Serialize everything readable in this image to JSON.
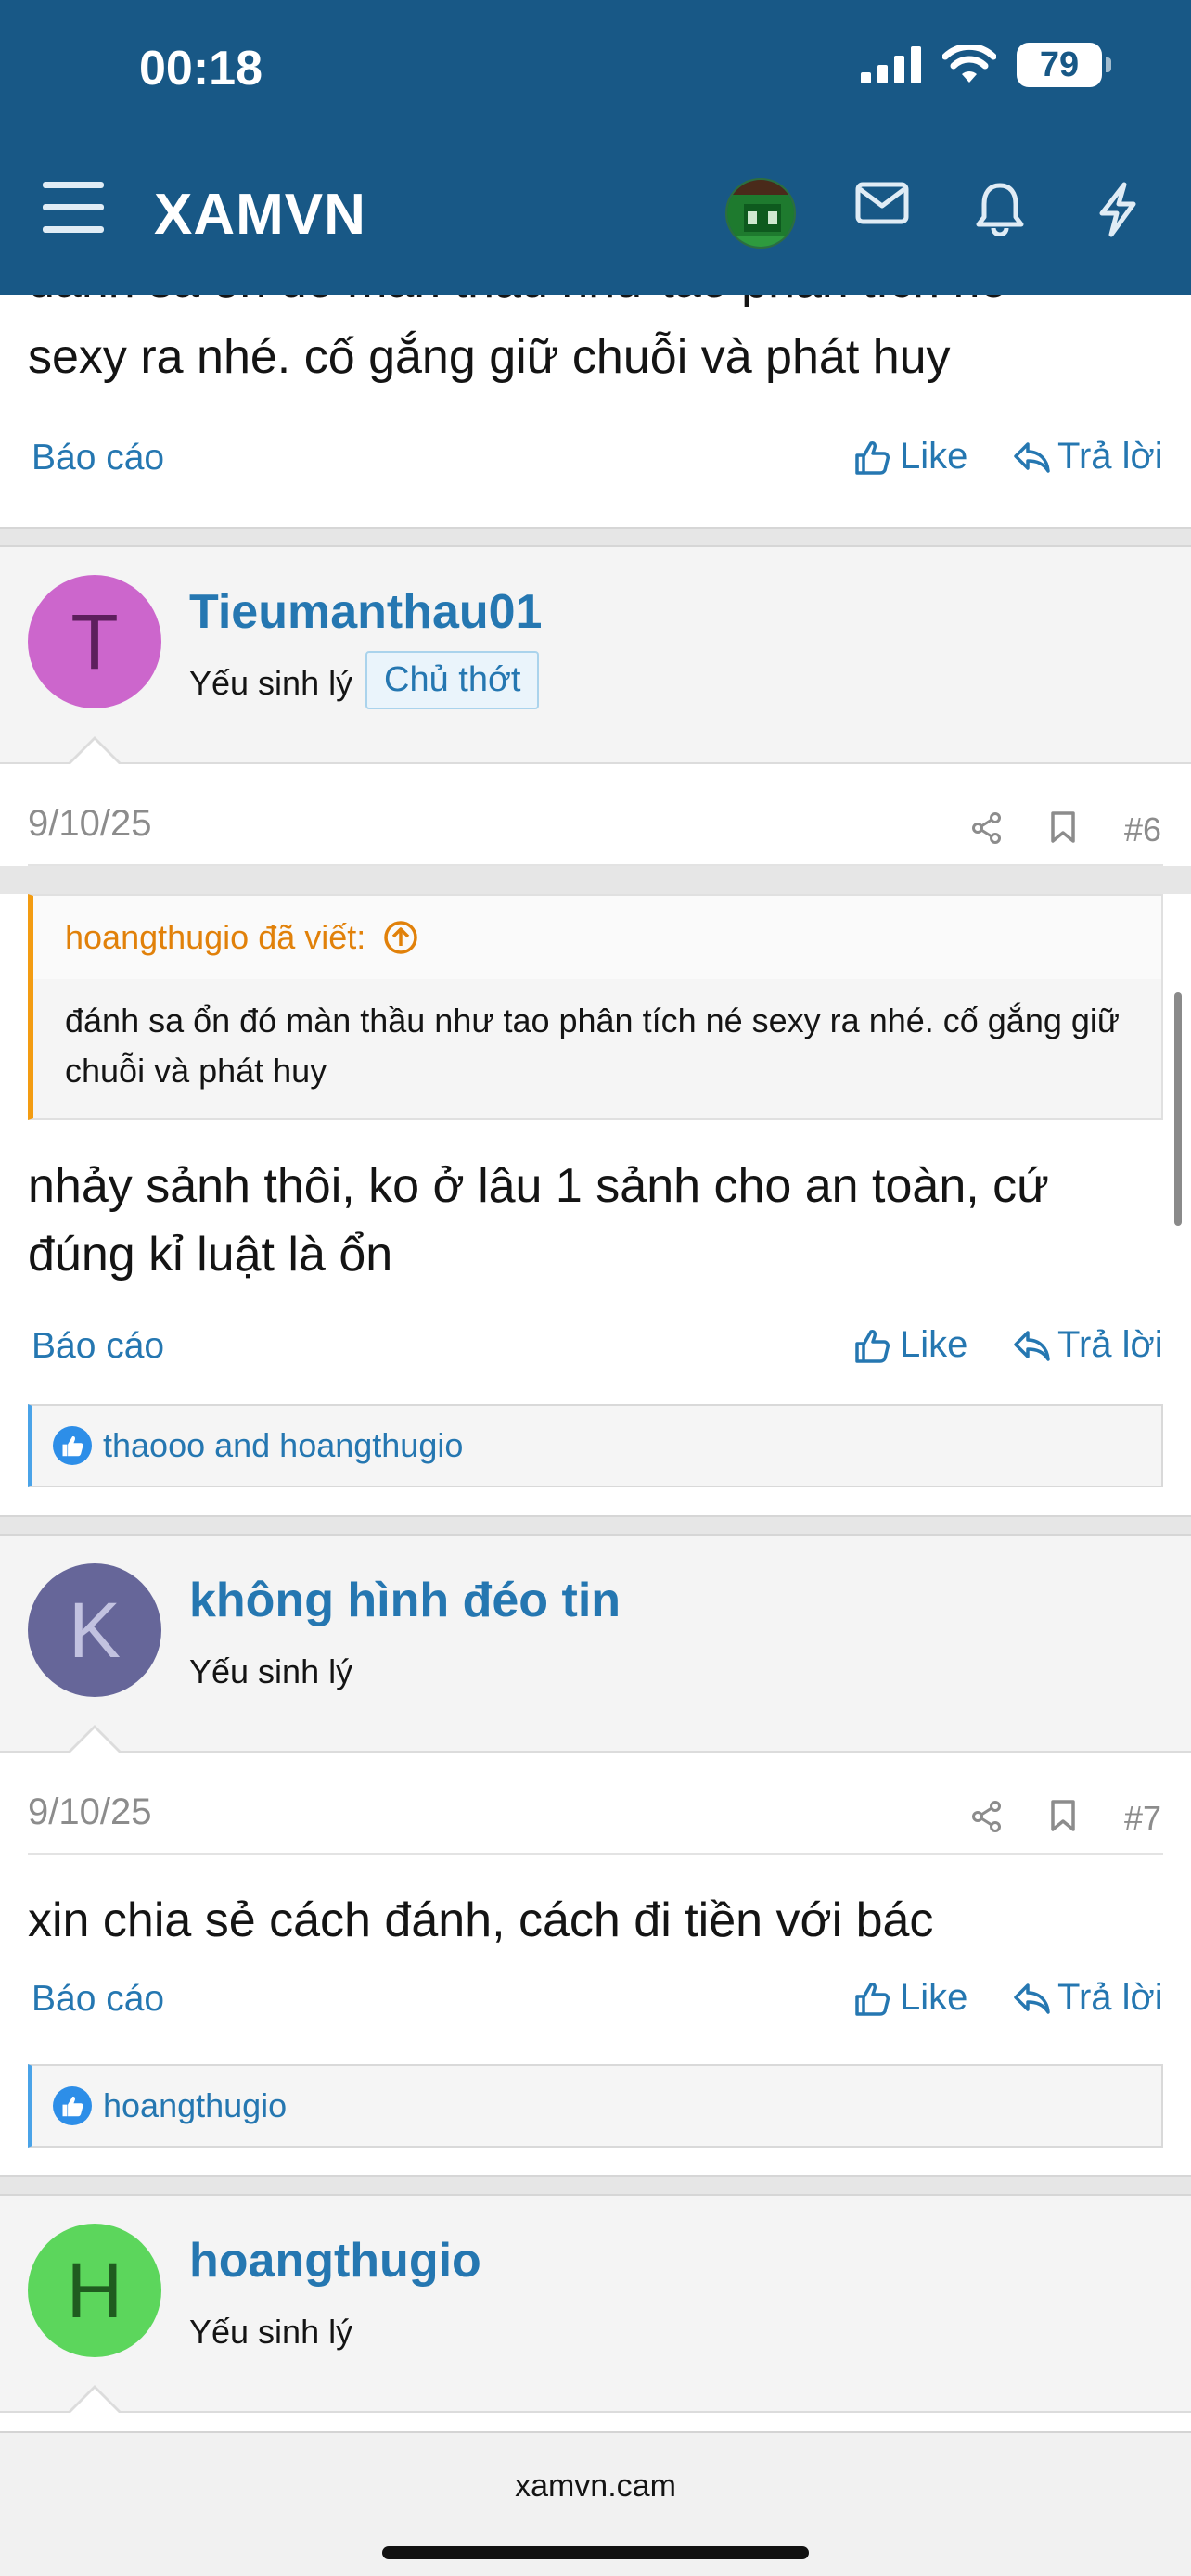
{
  "status_bar": {
    "time": "00:18",
    "battery": "79"
  },
  "header": {
    "logo": "XAMVN"
  },
  "labels": {
    "report": "Báo cáo",
    "like": "Like",
    "reply": "Trả lời",
    "quote_suffix": "đã viết:"
  },
  "post5": {
    "text_clipped": "đánh sa ổn đó màn thầu như tao phân tích né",
    "text_visible": "sexy ra nhé. cố gắng giữ chuỗi và phát huy"
  },
  "post6": {
    "initial": "T",
    "avatar_color": "#cc66cc",
    "username": "Tieumanthau01",
    "user_title": "Yếu sinh lý",
    "badge": "Chủ thớt",
    "date": "9/10/25",
    "number": "#6",
    "quote_author": "hoangthugio",
    "quote_text": "đánh sa ổn đó màn thầu như tao phân tích né sexy ra nhé. cố gắng giữ chuỗi và phát huy",
    "message": "nhảy sảnh thôi, ko ở lâu 1 sảnh cho an toàn, cứ đúng kỉ luật là ổn",
    "reactions": "thaooo and hoangthugio"
  },
  "post7": {
    "initial": "K",
    "avatar_color": "#666699",
    "username": "không hình đéo tin",
    "user_title": "Yếu sinh lý",
    "date": "9/10/25",
    "number": "#7",
    "message": "xin chia sẻ cách đánh, cách đi tiền với bác",
    "reactions": "hoangthugio"
  },
  "post8": {
    "initial": "H",
    "avatar_color": "#5cd65c",
    "username": "hoangthugio",
    "user_title": "Yếu sinh lý"
  },
  "browser": {
    "url": "xamvn.cam"
  },
  "colors": {
    "header": "#185886",
    "link": "#2577b1",
    "quote_accent": "#f39c12"
  }
}
